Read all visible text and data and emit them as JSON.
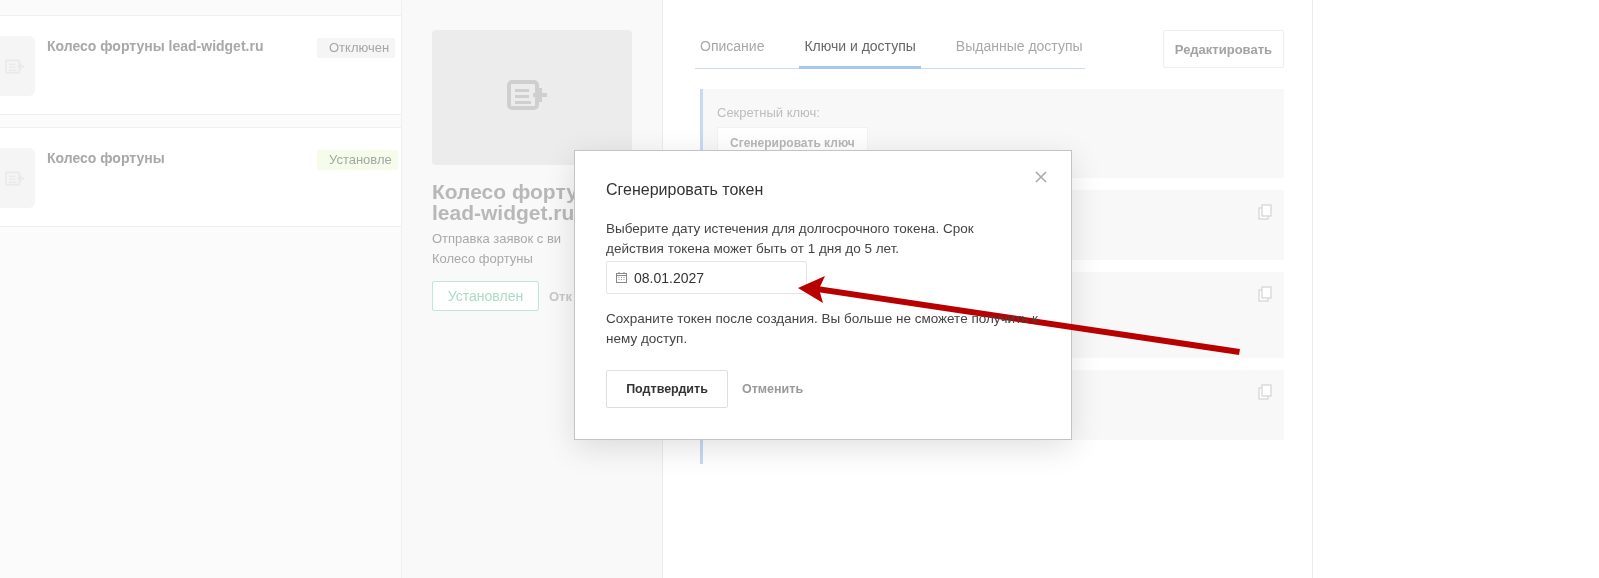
{
  "list": {
    "items": [
      {
        "title": "Колесо фортуны lead-widget.ru",
        "status": "Отключен",
        "kind": "off"
      },
      {
        "title": "Колесо фортуны",
        "status": "Установле",
        "kind": "installed"
      }
    ]
  },
  "detail": {
    "title_lines": [
      "Колесо форту",
      "lead-widget.ru"
    ],
    "description_lines": [
      "Отправка заявок с ви",
      "Колесо фортуны"
    ],
    "status_button": "Установлен",
    "action_link": "Отк"
  },
  "panel": {
    "tabs": [
      {
        "label": "Описание",
        "selected": false
      },
      {
        "label": "Ключи и доступы",
        "selected": true
      },
      {
        "label": "Выданные доступы",
        "selected": false
      }
    ],
    "edit_button": "Редактировать",
    "secret_key": {
      "label": "Секретный ключ:",
      "button": "Сгенерировать ключ"
    },
    "token_blocks": [
      {
        "copyable": true
      },
      {
        "copyable": true
      },
      {
        "copyable": true
      }
    ]
  },
  "modal": {
    "title": "Сгенерировать токен",
    "text": "Выберите дату истечения для долгосрочного токена. Срок действия токена может быть от 1 дня до 5 лет.",
    "date_value": "08.01.2027",
    "note": "Сохраните токен после создания. Вы больше не сможете получить к нему доступ.",
    "confirm_button": "Подтвердить",
    "cancel_button": "Отменить"
  }
}
